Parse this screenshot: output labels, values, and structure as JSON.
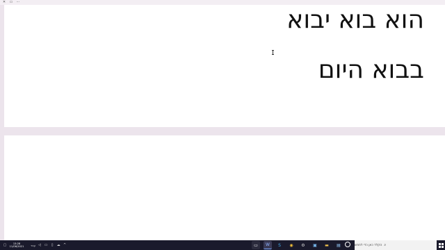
{
  "document": {
    "line1": "הוא בוא יבוא",
    "line2": "בבוא היום"
  },
  "taskbar": {
    "time": "13:28",
    "date": "11/06/2021",
    "language": "עבר",
    "search_placeholder": "הקלד כאן כדי לחפש"
  },
  "colors": {
    "taskbar_bg": "#1a1a2c",
    "workspace_bg": "#ece4ec",
    "page_bg": "#ffffff"
  }
}
